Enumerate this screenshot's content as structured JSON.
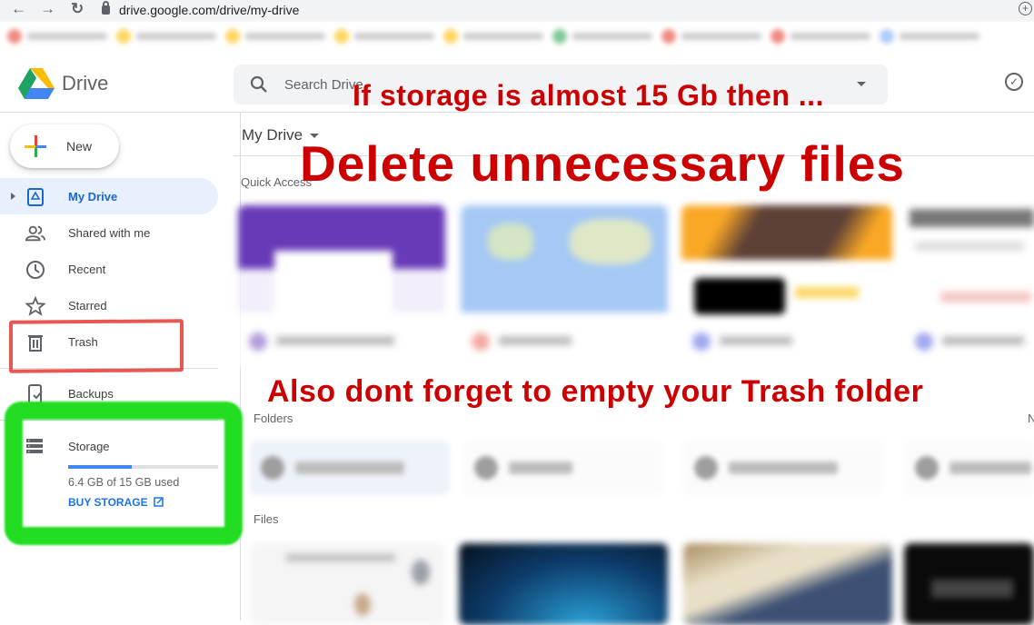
{
  "browser": {
    "url": "drive.google.com/drive/my-drive",
    "back_icon": "arrow-left-icon",
    "forward_icon": "arrow-right-icon",
    "reload_icon": "reload-icon",
    "lock_icon": "lock-icon",
    "add_icon": "plus-circle-icon"
  },
  "app": {
    "name": "Drive",
    "search_placeholder": "Search Drive",
    "new_label": "New"
  },
  "sidebar": {
    "items": [
      {
        "label": "My Drive",
        "icon": "my-drive-icon",
        "active": true
      },
      {
        "label": "Shared with me",
        "icon": "people-icon"
      },
      {
        "label": "Recent",
        "icon": "clock-icon"
      },
      {
        "label": "Starred",
        "icon": "star-icon"
      },
      {
        "label": "Trash",
        "icon": "trash-icon"
      },
      {
        "label": "Backups",
        "icon": "backup-icon"
      }
    ],
    "storage": {
      "label": "Storage",
      "used_text": "6.4 GB of 15 GB used",
      "used_fraction": 0.427,
      "buy_label": "BUY STORAGE"
    }
  },
  "main": {
    "location": "My Drive",
    "quick_access_label": "Quick Access",
    "folders_label": "Folders",
    "files_label": "Files",
    "name_sort_partial": "N"
  },
  "annotations": {
    "line1": "If storage is almost 15 Gb then ...",
    "line2": "Delete unnecessary files",
    "line3": "Also dont forget to empty your Trash folder",
    "color": "#cc0000",
    "trash_highlight_color": "#e53935",
    "storage_highlight_color": "#22dd22"
  },
  "colors": {
    "accent_blue": "#1a73e8",
    "active_bg": "#e8f0fe"
  }
}
